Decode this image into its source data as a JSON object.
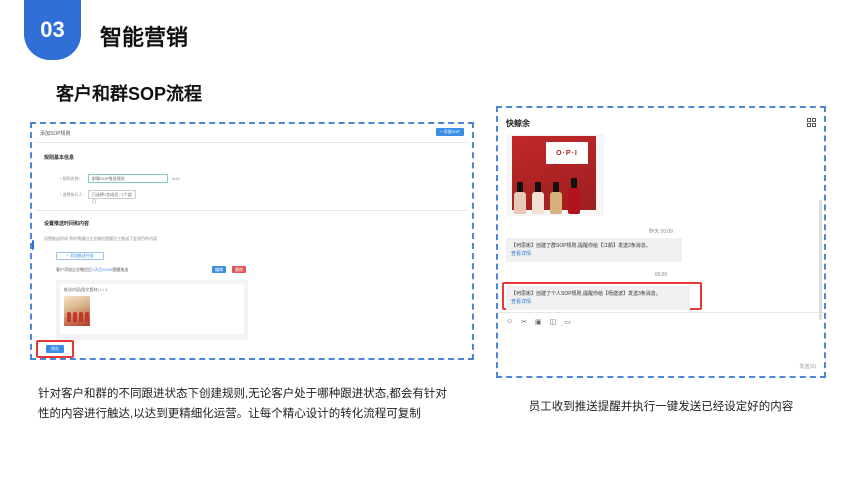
{
  "section": {
    "number": "03",
    "title": "智能营销"
  },
  "subtitle": "客户和群SOP流程",
  "left_screen": {
    "header_title": "添加SOP规则",
    "header_button": "+ 添加SOP",
    "basic_info": "规则基本信息",
    "rule_name_label": "* 规则名称:",
    "rule_name_value": "群聊SOP推送规则",
    "rule_name_hint": "0/20",
    "executor_label": "* 选择执行人:",
    "executor_value": "已选择1名成员 / 1个部门",
    "push_section": "设置推送时间和内容",
    "push_desc": "设置推送时间,到时将通过企业微信提醒员工推送了此项目的内容",
    "add_task": "+ 添加推送任务",
    "task_text": "客户添加企业微信后",
    "task_highlight": "1天后09:00",
    "task_tail": "提醒推送",
    "edit_button": "编辑",
    "delete_button": "删除",
    "message_text": "推送内容(图文素材) 1 / 1",
    "save_button": "保存"
  },
  "right_screen": {
    "contact_name": "快鲸余",
    "product_brand": "O·P·I",
    "time_1": "昨天 20:09",
    "msg_1": "【何思彬】创建了群SOP规则,提醒你给【江颜】发送2条消息。",
    "msg_1_link": "查看详情",
    "time_2": "00:00",
    "msg_2": "【何思彬】创建了个人SOP规则,提醒你给【杨建波】发送3条消息。",
    "msg_2_link": "查看详情",
    "toolbar_icons": [
      "smile-icon",
      "scissors-icon",
      "image-icon",
      "screenshot-icon",
      "folder-icon"
    ],
    "send_label": "发送(S)"
  },
  "caption_left": "针对客户和群的不同跟进状态下创建规则,无论客户处于哪种跟进状态,都会有针对性的内容进行触达,以达到更精细化运营。让每个精心设计的转化流程可复制",
  "caption_right": "员工收到推送提醒并执行一键发送已经设定好的内容",
  "colors": {
    "accent": "#2f6fd6",
    "dash": "#4b86d8",
    "highlight": "#e53935",
    "link": "#3a7dd8"
  }
}
